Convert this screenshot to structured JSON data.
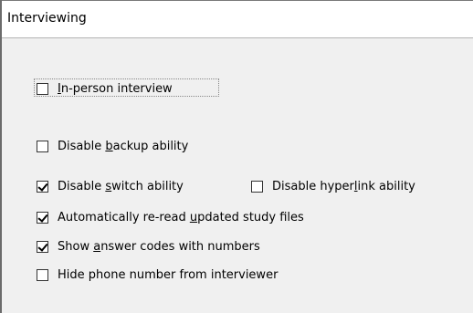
{
  "header": {
    "title": "Interviewing"
  },
  "options": {
    "in_person": {
      "pre": "",
      "key": "I",
      "post": "n-person interview",
      "checked": false
    },
    "disable_backup": {
      "pre": "Disable ",
      "key": "b",
      "post": "ackup ability",
      "checked": false
    },
    "disable_switch": {
      "pre": "Disable ",
      "key": "s",
      "post": "witch ability",
      "checked": true
    },
    "disable_hyperlink": {
      "pre": "Disable hyper",
      "key": "l",
      "post": "ink ability",
      "checked": false
    },
    "auto_reread": {
      "pre": "Automatically re-read ",
      "key": "u",
      "post": "pdated study files",
      "checked": true
    },
    "show_answer_codes": {
      "pre": "Show ",
      "key": "a",
      "post": "nswer codes with numbers",
      "checked": true
    },
    "hide_phone": {
      "pre": "Hide phone number from interviewer",
      "key": "",
      "post": "",
      "checked": false
    }
  }
}
